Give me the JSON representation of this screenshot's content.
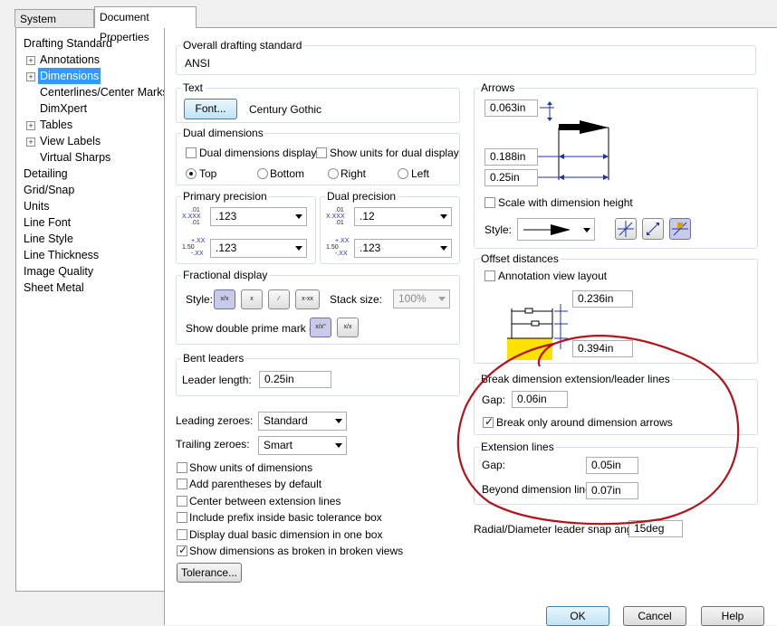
{
  "tabs": {
    "system_options": "System Options",
    "document_properties": "Document Properties"
  },
  "tree": [
    {
      "label": "Drafting Standard",
      "level": 0,
      "expander": false,
      "selected": false
    },
    {
      "label": "Annotations",
      "level": 1,
      "expander": true,
      "selected": false
    },
    {
      "label": "Dimensions",
      "level": 1,
      "expander": true,
      "selected": true
    },
    {
      "label": "Centerlines/Center Marks",
      "level": 1,
      "expander": false,
      "selected": false
    },
    {
      "label": "DimXpert",
      "level": 1,
      "expander": false,
      "selected": false
    },
    {
      "label": "Tables",
      "level": 1,
      "expander": true,
      "selected": false
    },
    {
      "label": "View Labels",
      "level": 1,
      "expander": true,
      "selected": false
    },
    {
      "label": "Virtual Sharps",
      "level": 1,
      "expander": false,
      "selected": false
    },
    {
      "label": "Detailing",
      "level": 0,
      "expander": false,
      "selected": false
    },
    {
      "label": "Grid/Snap",
      "level": 0,
      "expander": false,
      "selected": false
    },
    {
      "label": "Units",
      "level": 0,
      "expander": false,
      "selected": false
    },
    {
      "label": "Line Font",
      "level": 0,
      "expander": false,
      "selected": false
    },
    {
      "label": "Line Style",
      "level": 0,
      "expander": false,
      "selected": false
    },
    {
      "label": "Line Thickness",
      "level": 0,
      "expander": false,
      "selected": false
    },
    {
      "label": "Image Quality",
      "level": 0,
      "expander": false,
      "selected": false
    },
    {
      "label": "Sheet Metal",
      "level": 0,
      "expander": false,
      "selected": false
    }
  ],
  "overall": {
    "title": "Overall drafting standard",
    "value": "ANSI"
  },
  "text": {
    "title": "Text",
    "font_button": "Font...",
    "font_name": "Century Gothic"
  },
  "dual": {
    "title": "Dual dimensions",
    "display": "Dual dimensions display",
    "show_units": "Show units for dual display",
    "top": "Top",
    "bottom": "Bottom",
    "right": "Right",
    "left": "Left"
  },
  "primary": {
    "title": "Primary precision",
    "value1": ".123",
    "value2": ".123"
  },
  "dualprec": {
    "title": "Dual precision",
    "value1": ".12",
    "value2": ".123"
  },
  "precision_icons": {
    "top_main": "X.XXX",
    "top_sup": ".01",
    "top_sub": ".01",
    "bottom_main": "1.50",
    "bottom_sup": "+.XX",
    "bottom_sub": "-.XX"
  },
  "fractional": {
    "title": "Fractional display",
    "style": "Style:",
    "stack_size": "Stack size:",
    "stack_value": "100%",
    "double_prime": "Show double prime mark (\"):",
    "style_icons": [
      "x/x",
      "x/xx",
      "x/x diag",
      "x-xx"
    ],
    "prime_icons": [
      "x/x\"",
      "x/x"
    ]
  },
  "bent": {
    "title": "Bent leaders",
    "leader_length_label": "Leader length:",
    "leader_length": "0.25in"
  },
  "zeroes": {
    "leading_label": "Leading zeroes:",
    "leading": "Standard",
    "trailing_label": "Trailing zeroes:",
    "trailing": "Smart"
  },
  "checks": [
    {
      "label": "Show units of dimensions",
      "checked": false
    },
    {
      "label": "Add parentheses by default",
      "checked": false
    },
    {
      "label": "Center between extension lines",
      "checked": false
    },
    {
      "label": "Include prefix inside basic tolerance box",
      "checked": false
    },
    {
      "label": "Display dual basic dimension in one box",
      "checked": false
    },
    {
      "label": "Show dimensions as broken in broken views",
      "checked": true
    }
  ],
  "tolerance_button": "Tolerance...",
  "arrows": {
    "title": "Arrows",
    "size1": "0.063in",
    "size2": "0.188in",
    "size3": "0.25in",
    "scale": "Scale with dimension height",
    "style": "Style:"
  },
  "offset": {
    "title": "Offset distances",
    "annotation_layout": "Annotation view layout",
    "dist1": "0.236in",
    "dist2": "0.394in"
  },
  "break_lines": {
    "title": "Break dimension extension/leader lines",
    "gap_label": "Gap:",
    "gap": "0.06in",
    "only_arrows": "Break only around dimension arrows"
  },
  "extension": {
    "title": "Extension lines",
    "gap_label": "Gap:",
    "gap": "0.05in",
    "beyond_label": "Beyond dimension line:",
    "beyond": "0.07in"
  },
  "radial": {
    "label": "Radial/Diameter leader snap angle:",
    "value": "15deg"
  },
  "footer": {
    "ok": "OK",
    "cancel": "Cancel",
    "help": "Help"
  },
  "annotation_color": "#b3131a"
}
